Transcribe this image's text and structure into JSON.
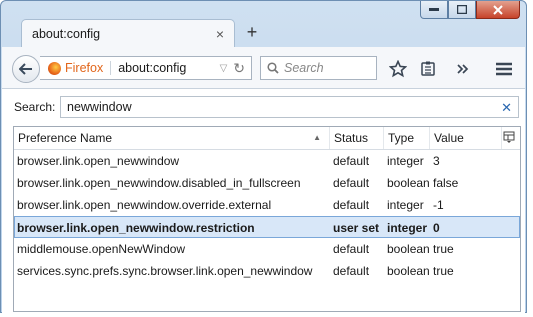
{
  "tab": {
    "title": "about:config",
    "close": "×"
  },
  "new_tab": "+",
  "window_controls": {
    "minimize": "▬",
    "maximize": "▢",
    "close": "✕"
  },
  "url_bar": {
    "identity": "Firefox",
    "url": "about:config",
    "dropdown": "▽",
    "reload": "↻"
  },
  "search_box": {
    "placeholder": "Search"
  },
  "filter": {
    "label": "Search:",
    "value": "newwindow",
    "clear": "✕"
  },
  "table": {
    "columns": [
      "Preference Name",
      "Status",
      "Type",
      "Value"
    ],
    "sort_indicator": "▲",
    "rows": [
      {
        "name": "browser.link.open_newwindow",
        "status": "default",
        "type": "integer",
        "value": "3",
        "selected": false
      },
      {
        "name": "browser.link.open_newwindow.disabled_in_fullscreen",
        "status": "default",
        "type": "boolean",
        "value": "false",
        "selected": false
      },
      {
        "name": "browser.link.open_newwindow.override.external",
        "status": "default",
        "type": "integer",
        "value": "-1",
        "selected": false
      },
      {
        "name": "browser.link.open_newwindow.restriction",
        "status": "user set",
        "type": "integer",
        "value": "0",
        "selected": true
      },
      {
        "name": "middlemouse.openNewWindow",
        "status": "default",
        "type": "boolean",
        "value": "true",
        "selected": false
      },
      {
        "name": "services.sync.prefs.sync.browser.link.open_newwindow",
        "status": "default",
        "type": "boolean",
        "value": "true",
        "selected": false
      }
    ]
  },
  "colors": {
    "accent": "#e2661b",
    "selection": "#d8e7f8",
    "clear_icon": "#2a68b0"
  }
}
